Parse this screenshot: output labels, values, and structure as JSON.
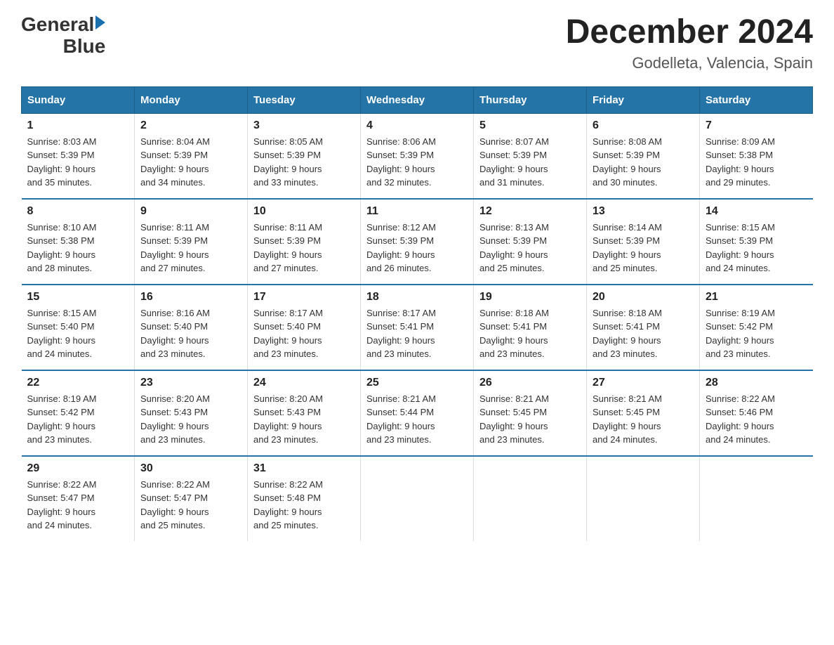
{
  "logo": {
    "text_general": "General",
    "text_blue": "Blue"
  },
  "title": "December 2024",
  "subtitle": "Godelleta, Valencia, Spain",
  "days_of_week": [
    "Sunday",
    "Monday",
    "Tuesday",
    "Wednesday",
    "Thursday",
    "Friday",
    "Saturday"
  ],
  "weeks": [
    [
      {
        "num": "1",
        "info": "Sunrise: 8:03 AM\nSunset: 5:39 PM\nDaylight: 9 hours\nand 35 minutes."
      },
      {
        "num": "2",
        "info": "Sunrise: 8:04 AM\nSunset: 5:39 PM\nDaylight: 9 hours\nand 34 minutes."
      },
      {
        "num": "3",
        "info": "Sunrise: 8:05 AM\nSunset: 5:39 PM\nDaylight: 9 hours\nand 33 minutes."
      },
      {
        "num": "4",
        "info": "Sunrise: 8:06 AM\nSunset: 5:39 PM\nDaylight: 9 hours\nand 32 minutes."
      },
      {
        "num": "5",
        "info": "Sunrise: 8:07 AM\nSunset: 5:39 PM\nDaylight: 9 hours\nand 31 minutes."
      },
      {
        "num": "6",
        "info": "Sunrise: 8:08 AM\nSunset: 5:39 PM\nDaylight: 9 hours\nand 30 minutes."
      },
      {
        "num": "7",
        "info": "Sunrise: 8:09 AM\nSunset: 5:38 PM\nDaylight: 9 hours\nand 29 minutes."
      }
    ],
    [
      {
        "num": "8",
        "info": "Sunrise: 8:10 AM\nSunset: 5:38 PM\nDaylight: 9 hours\nand 28 minutes."
      },
      {
        "num": "9",
        "info": "Sunrise: 8:11 AM\nSunset: 5:39 PM\nDaylight: 9 hours\nand 27 minutes."
      },
      {
        "num": "10",
        "info": "Sunrise: 8:11 AM\nSunset: 5:39 PM\nDaylight: 9 hours\nand 27 minutes."
      },
      {
        "num": "11",
        "info": "Sunrise: 8:12 AM\nSunset: 5:39 PM\nDaylight: 9 hours\nand 26 minutes."
      },
      {
        "num": "12",
        "info": "Sunrise: 8:13 AM\nSunset: 5:39 PM\nDaylight: 9 hours\nand 25 minutes."
      },
      {
        "num": "13",
        "info": "Sunrise: 8:14 AM\nSunset: 5:39 PM\nDaylight: 9 hours\nand 25 minutes."
      },
      {
        "num": "14",
        "info": "Sunrise: 8:15 AM\nSunset: 5:39 PM\nDaylight: 9 hours\nand 24 minutes."
      }
    ],
    [
      {
        "num": "15",
        "info": "Sunrise: 8:15 AM\nSunset: 5:40 PM\nDaylight: 9 hours\nand 24 minutes."
      },
      {
        "num": "16",
        "info": "Sunrise: 8:16 AM\nSunset: 5:40 PM\nDaylight: 9 hours\nand 23 minutes."
      },
      {
        "num": "17",
        "info": "Sunrise: 8:17 AM\nSunset: 5:40 PM\nDaylight: 9 hours\nand 23 minutes."
      },
      {
        "num": "18",
        "info": "Sunrise: 8:17 AM\nSunset: 5:41 PM\nDaylight: 9 hours\nand 23 minutes."
      },
      {
        "num": "19",
        "info": "Sunrise: 8:18 AM\nSunset: 5:41 PM\nDaylight: 9 hours\nand 23 minutes."
      },
      {
        "num": "20",
        "info": "Sunrise: 8:18 AM\nSunset: 5:41 PM\nDaylight: 9 hours\nand 23 minutes."
      },
      {
        "num": "21",
        "info": "Sunrise: 8:19 AM\nSunset: 5:42 PM\nDaylight: 9 hours\nand 23 minutes."
      }
    ],
    [
      {
        "num": "22",
        "info": "Sunrise: 8:19 AM\nSunset: 5:42 PM\nDaylight: 9 hours\nand 23 minutes."
      },
      {
        "num": "23",
        "info": "Sunrise: 8:20 AM\nSunset: 5:43 PM\nDaylight: 9 hours\nand 23 minutes."
      },
      {
        "num": "24",
        "info": "Sunrise: 8:20 AM\nSunset: 5:43 PM\nDaylight: 9 hours\nand 23 minutes."
      },
      {
        "num": "25",
        "info": "Sunrise: 8:21 AM\nSunset: 5:44 PM\nDaylight: 9 hours\nand 23 minutes."
      },
      {
        "num": "26",
        "info": "Sunrise: 8:21 AM\nSunset: 5:45 PM\nDaylight: 9 hours\nand 23 minutes."
      },
      {
        "num": "27",
        "info": "Sunrise: 8:21 AM\nSunset: 5:45 PM\nDaylight: 9 hours\nand 24 minutes."
      },
      {
        "num": "28",
        "info": "Sunrise: 8:22 AM\nSunset: 5:46 PM\nDaylight: 9 hours\nand 24 minutes."
      }
    ],
    [
      {
        "num": "29",
        "info": "Sunrise: 8:22 AM\nSunset: 5:47 PM\nDaylight: 9 hours\nand 24 minutes."
      },
      {
        "num": "30",
        "info": "Sunrise: 8:22 AM\nSunset: 5:47 PM\nDaylight: 9 hours\nand 25 minutes."
      },
      {
        "num": "31",
        "info": "Sunrise: 8:22 AM\nSunset: 5:48 PM\nDaylight: 9 hours\nand 25 minutes."
      },
      {
        "num": "",
        "info": ""
      },
      {
        "num": "",
        "info": ""
      },
      {
        "num": "",
        "info": ""
      },
      {
        "num": "",
        "info": ""
      }
    ]
  ]
}
